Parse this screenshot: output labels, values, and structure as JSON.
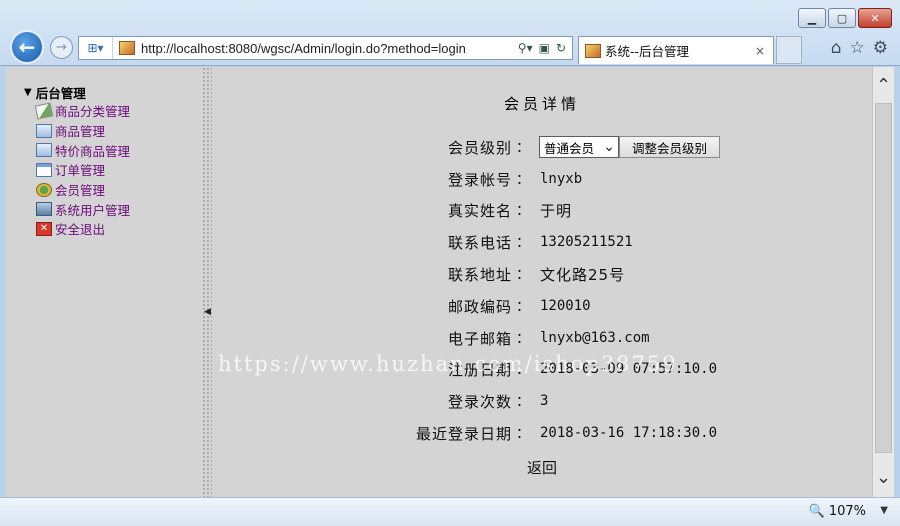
{
  "browser": {
    "address_url": "http://localhost:8080/wgsc/Admin/login.do?method=login",
    "tab_title": "系统--后台管理",
    "tab_close": "×",
    "zoom_level": "107%"
  },
  "sidebar": {
    "root_label": "后台管理",
    "items": [
      {
        "label": "商品分类管理",
        "icon": "category-icon"
      },
      {
        "label": "商品管理",
        "icon": "product-icon"
      },
      {
        "label": "特价商品管理",
        "icon": "special-product-icon"
      },
      {
        "label": "订单管理",
        "icon": "order-icon"
      },
      {
        "label": "会员管理",
        "icon": "member-icon"
      },
      {
        "label": "系统用户管理",
        "icon": "user-icon"
      },
      {
        "label": "安全退出",
        "icon": "exit-icon"
      }
    ]
  },
  "main": {
    "title": "会员详情",
    "colon": "：",
    "level": {
      "label": "会员级别",
      "selected": "普通会员",
      "adjust_button": "调整会员级别"
    },
    "fields": [
      {
        "label": "登录帐号",
        "value": "lnyxb"
      },
      {
        "label": "真实姓名",
        "value": "于明"
      },
      {
        "label": "联系电话",
        "value": "13205211521"
      },
      {
        "label": "联系地址",
        "value": "文化路25号"
      },
      {
        "label": "邮政编码",
        "value": "120010"
      },
      {
        "label": "电子邮箱",
        "value": "lnyxb@163.com"
      },
      {
        "label": "注册日期",
        "value": "2018-03-09 07:57:10.0"
      },
      {
        "label": "登录次数",
        "value": "3"
      },
      {
        "label": "最近登录日期",
        "value": "2018-03-16 17:18:30.0"
      }
    ],
    "return_label": "返回"
  },
  "watermark": "https://www.huzhan.com/ishop38759"
}
